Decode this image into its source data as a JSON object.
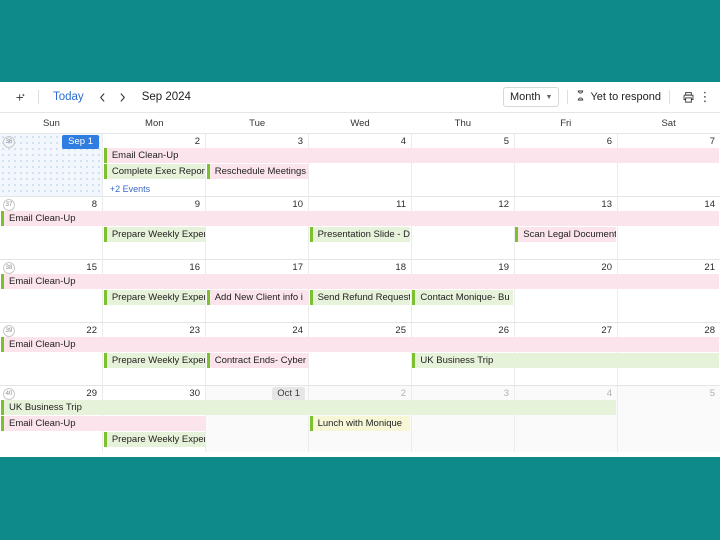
{
  "theme": {
    "page_background": "#0e8a8a",
    "accent_blue": "#2b6cd4",
    "event_bar_green": "#7cbf2f",
    "event_pink": "#fbe4ec",
    "event_green": "#e7f2da",
    "event_yellow": "#f7f7d8",
    "today_badge": "#2f7de1"
  },
  "toolbar": {
    "create_icon": "create-event-icon",
    "today_label": "Today",
    "prev_icon": "chevron-left-icon",
    "next_icon": "chevron-right-icon",
    "period_label": "Sep 2024",
    "view_label": "Month",
    "view_caret_icon": "chevron-down-icon",
    "respond_icon": "hourglass-icon",
    "respond_label": "Yet to respond",
    "print_icon": "printer-icon",
    "more_icon": "vertical-dots-icon"
  },
  "weekdays": [
    "Sun",
    "Mon",
    "Tue",
    "Wed",
    "Thu",
    "Fri",
    "Sat"
  ],
  "weeks": [
    {
      "number": "36",
      "days": [
        {
          "label": "Sep 1",
          "style": "today"
        },
        {
          "label": "2",
          "style": "normal"
        },
        {
          "label": "3",
          "style": "normal"
        },
        {
          "label": "4",
          "style": "normal"
        },
        {
          "label": "5",
          "style": "normal"
        },
        {
          "label": "6",
          "style": "normal"
        },
        {
          "label": "7",
          "style": "normal"
        }
      ],
      "events": [
        {
          "title": "Email Clean-Up",
          "start": 1,
          "span": 6,
          "color": "pink",
          "row": 0
        },
        {
          "title": "Complete Exec Repor",
          "start": 1,
          "span": 1,
          "color": "green",
          "row": 1
        },
        {
          "title": "Reschedule Meetings",
          "start": 2,
          "span": 1,
          "color": "pink",
          "row": 1
        }
      ],
      "more": {
        "label": "+2 Events",
        "col": 1,
        "row": 2
      }
    },
    {
      "number": "37",
      "days": [
        {
          "label": "8",
          "style": "normal"
        },
        {
          "label": "9",
          "style": "normal"
        },
        {
          "label": "10",
          "style": "normal"
        },
        {
          "label": "11",
          "style": "normal"
        },
        {
          "label": "12",
          "style": "normal"
        },
        {
          "label": "13",
          "style": "normal"
        },
        {
          "label": "14",
          "style": "normal"
        }
      ],
      "events": [
        {
          "title": "Email Clean-Up",
          "start": 0,
          "span": 7,
          "color": "pink",
          "row": 0
        },
        {
          "title": "Prepare Weekly Exper",
          "start": 1,
          "span": 1,
          "color": "green",
          "row": 1
        },
        {
          "title": "Presentation Slide - D",
          "start": 3,
          "span": 1,
          "color": "green",
          "row": 1
        },
        {
          "title": "Scan Legal Document",
          "start": 5,
          "span": 1,
          "color": "pink",
          "row": 1
        }
      ],
      "more": null
    },
    {
      "number": "38",
      "days": [
        {
          "label": "15",
          "style": "normal"
        },
        {
          "label": "16",
          "style": "normal"
        },
        {
          "label": "17",
          "style": "normal"
        },
        {
          "label": "18",
          "style": "normal"
        },
        {
          "label": "19",
          "style": "normal"
        },
        {
          "label": "20",
          "style": "normal"
        },
        {
          "label": "21",
          "style": "normal"
        }
      ],
      "events": [
        {
          "title": "Email Clean-Up",
          "start": 0,
          "span": 7,
          "color": "pink",
          "row": 0
        },
        {
          "title": "Prepare Weekly Exper",
          "start": 1,
          "span": 1,
          "color": "green",
          "row": 1
        },
        {
          "title": "Add New Client info i",
          "start": 2,
          "span": 1,
          "color": "pink",
          "row": 1
        },
        {
          "title": "Send Refund Request",
          "start": 3,
          "span": 1,
          "color": "green",
          "row": 1
        },
        {
          "title": "Contact Monique- Bu",
          "start": 4,
          "span": 1,
          "color": "green",
          "row": 1
        }
      ],
      "more": null
    },
    {
      "number": "39",
      "days": [
        {
          "label": "22",
          "style": "normal"
        },
        {
          "label": "23",
          "style": "normal"
        },
        {
          "label": "24",
          "style": "normal"
        },
        {
          "label": "25",
          "style": "normal"
        },
        {
          "label": "26",
          "style": "normal"
        },
        {
          "label": "27",
          "style": "normal"
        },
        {
          "label": "28",
          "style": "normal"
        }
      ],
      "events": [
        {
          "title": "Email Clean-Up",
          "start": 0,
          "span": 7,
          "color": "pink",
          "row": 0
        },
        {
          "title": "Prepare Weekly Exper",
          "start": 1,
          "span": 1,
          "color": "green",
          "row": 1
        },
        {
          "title": "Contract Ends- Cyber",
          "start": 2,
          "span": 1,
          "color": "pink",
          "row": 1
        },
        {
          "title": "UK Business Trip",
          "start": 4,
          "span": 3,
          "color": "green",
          "row": 1
        }
      ],
      "more": null
    },
    {
      "number": "40",
      "days": [
        {
          "label": "29",
          "style": "normal"
        },
        {
          "label": "30",
          "style": "normal"
        },
        {
          "label": "Oct 1",
          "style": "pill"
        },
        {
          "label": "2",
          "style": "muted"
        },
        {
          "label": "3",
          "style": "muted"
        },
        {
          "label": "4",
          "style": "muted"
        },
        {
          "label": "5",
          "style": "muted"
        }
      ],
      "events": [
        {
          "title": "UK Business Trip",
          "start": 0,
          "span": 6,
          "color": "green",
          "row": 0
        },
        {
          "title": "Email Clean-Up",
          "start": 0,
          "span": 2,
          "color": "pink",
          "row": 1
        },
        {
          "title": "Lunch with Monique",
          "start": 3,
          "span": 1,
          "color": "yellow",
          "row": 1
        },
        {
          "title": "Prepare Weekly Exper",
          "start": 1,
          "span": 1,
          "color": "green",
          "row": 2
        }
      ],
      "more": null
    }
  ]
}
